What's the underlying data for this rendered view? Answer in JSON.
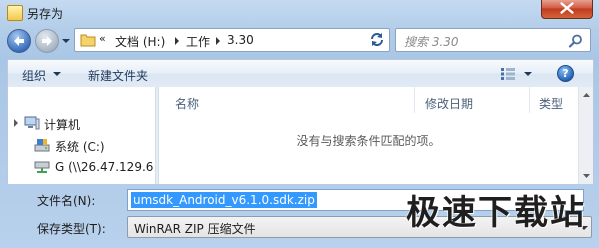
{
  "window": {
    "title": "另存为"
  },
  "navigation": {
    "breadcrumb_overflow": "«",
    "breadcrumbs": [
      "文档 (H:)",
      "工作",
      "3.30"
    ],
    "search_placeholder": "搜索 3.30"
  },
  "toolbar": {
    "organize_label": "组织",
    "new_folder_label": "新建文件夹",
    "help_label": "?"
  },
  "nav_pane": {
    "items": [
      {
        "label": "计算机",
        "icon": "computer-icon"
      },
      {
        "label": "系统 (C:)",
        "icon": "drive-icon"
      },
      {
        "label": "G (\\\\26.47.129.6",
        "icon": "network-drive-icon"
      }
    ]
  },
  "file_list": {
    "columns": [
      "名称",
      "修改日期",
      "类型"
    ],
    "empty_message": "没有与搜索条件匹配的项。"
  },
  "fields": {
    "filename_label": "文件名(N):",
    "filename_value": "umsdk_Android_v6.1.0.sdk.zip",
    "type_label": "保存类型(T):",
    "type_value": "WinRAR ZIP 压缩文件"
  },
  "watermark": {
    "text": "极速下载站"
  }
}
